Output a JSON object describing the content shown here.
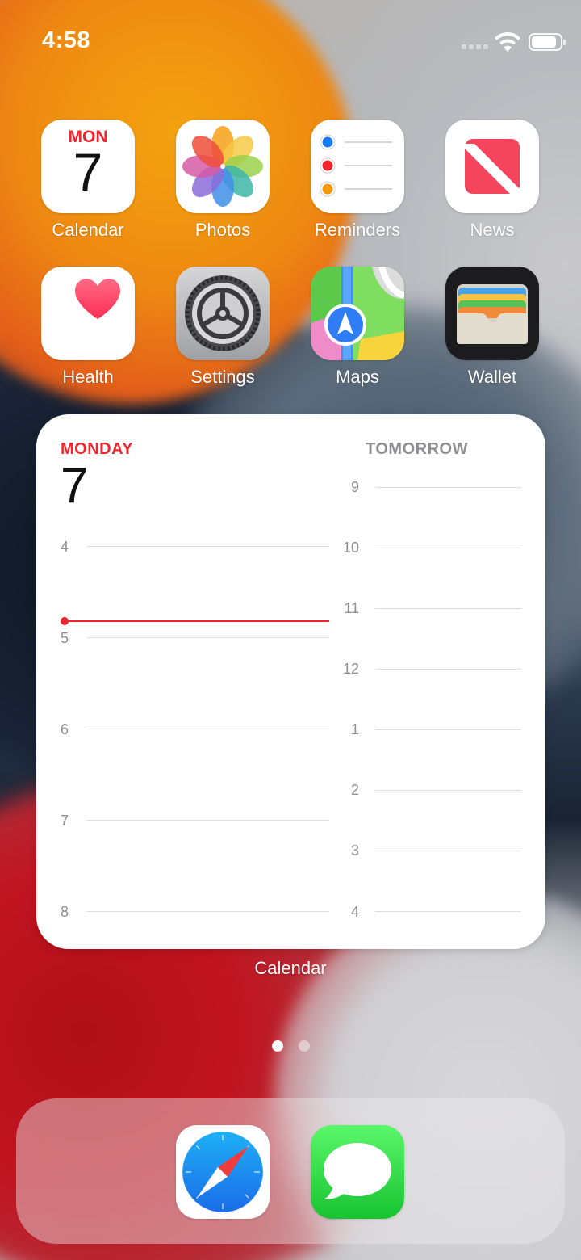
{
  "status_bar": {
    "time": "4:58",
    "battery_level": 0.9
  },
  "apps": [
    {
      "label": "Calendar",
      "icon": "calendar-icon",
      "calendar_day": "MON",
      "calendar_date": "7"
    },
    {
      "label": "Photos",
      "icon": "photos-icon"
    },
    {
      "label": "Reminders",
      "icon": "reminders-icon"
    },
    {
      "label": "News",
      "icon": "news-icon"
    },
    {
      "label": "Health",
      "icon": "health-icon"
    },
    {
      "label": "Settings",
      "icon": "settings-icon"
    },
    {
      "label": "Maps",
      "icon": "maps-icon"
    },
    {
      "label": "Wallet",
      "icon": "wallet-icon"
    }
  ],
  "widget": {
    "today_label": "MONDAY",
    "today_date": "7",
    "today_hours": [
      "4",
      "5",
      "6",
      "7",
      "8"
    ],
    "tomorrow_label": "TOMORROW",
    "tomorrow_hours": [
      "9",
      "10",
      "11",
      "12",
      "1",
      "2",
      "3",
      "4"
    ],
    "caption": "Calendar"
  },
  "page_indicator": {
    "pages": 2,
    "current": 1
  },
  "dock": [
    {
      "icon": "safari-icon"
    },
    {
      "icon": "messages-icon"
    }
  ],
  "colors": {
    "accent_red": "#f0252d",
    "secondary_gray": "#8e8e93"
  }
}
